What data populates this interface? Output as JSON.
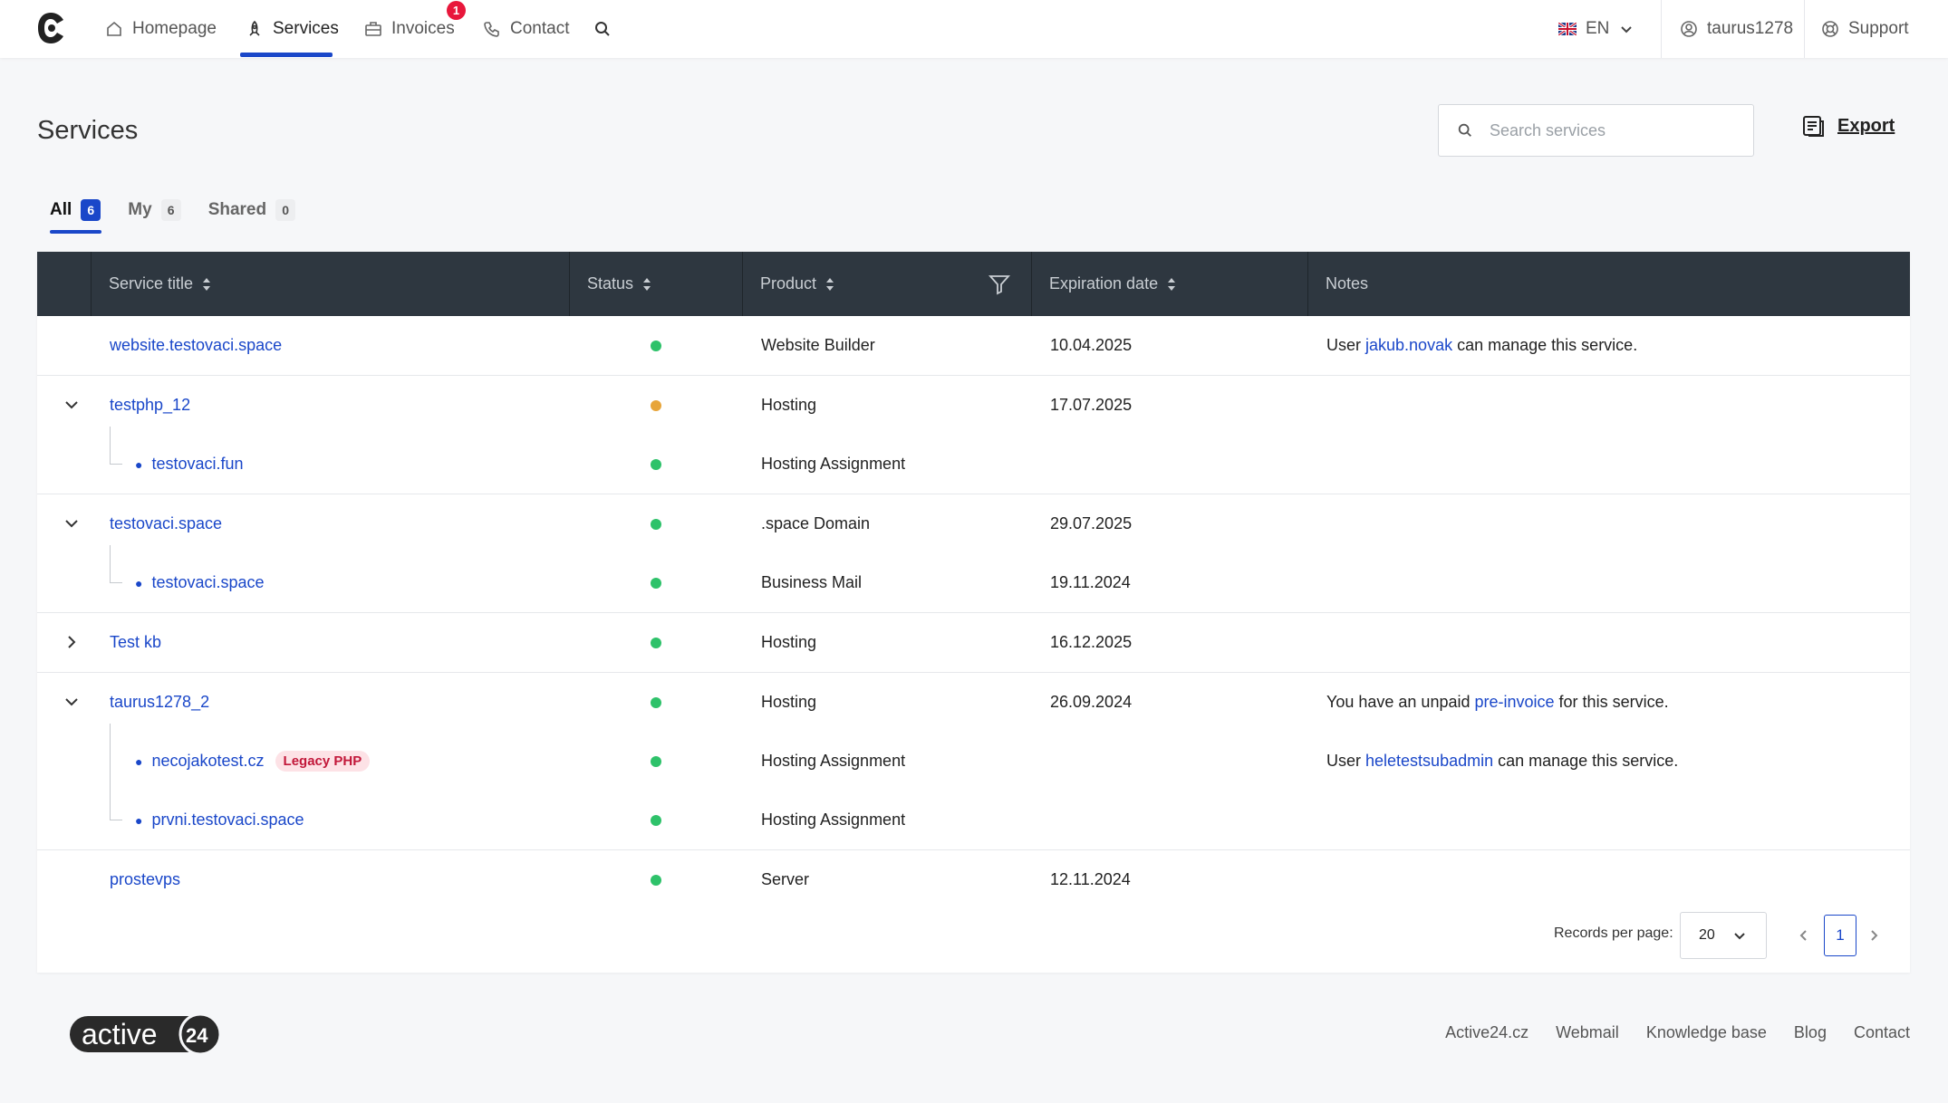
{
  "nav": {
    "items": [
      {
        "label": "Homepage",
        "icon": "home-icon"
      },
      {
        "label": "Services",
        "icon": "rocket-icon"
      },
      {
        "label": "Invoices",
        "icon": "briefcase-icon",
        "badge": "1"
      },
      {
        "label": "Contact",
        "icon": "phone-icon"
      }
    ],
    "language": "EN",
    "username": "taurus1278",
    "support": "Support"
  },
  "page": {
    "title": "Services",
    "search_placeholder": "Search services",
    "export_label": "Export"
  },
  "tabs": [
    {
      "label": "All",
      "count": "6"
    },
    {
      "label": "My",
      "count": "6"
    },
    {
      "label": "Shared",
      "count": "0"
    }
  ],
  "table": {
    "headers": {
      "service_title": "Service title",
      "status": "Status",
      "product": "Product",
      "expiration": "Expiration date",
      "notes": "Notes"
    },
    "rows": {
      "r1": {
        "title": "website.testovaci.space",
        "product": "Website Builder",
        "expiration": "10.04.2025",
        "note_pre": "User ",
        "note_link": "jakub.novak",
        "note_post": " can manage this service."
      },
      "r2": {
        "title": "testphp_12",
        "product": "Hosting",
        "expiration": "17.07.2025"
      },
      "r2a": {
        "title": "testovaci.fun",
        "product": "Hosting Assignment"
      },
      "r3": {
        "title": "testovaci.space",
        "product": ".space Domain",
        "expiration": "29.07.2025"
      },
      "r3a": {
        "title": "testovaci.space",
        "product": "Business Mail",
        "expiration": "19.11.2024"
      },
      "r4": {
        "title": "Test kb",
        "product": "Hosting",
        "expiration": "16.12.2025"
      },
      "r5": {
        "title": "taurus1278_2",
        "product": "Hosting",
        "expiration": "26.09.2024",
        "note_pre": "You have an unpaid ",
        "note_link": "pre-invoice",
        "note_post": " for this service."
      },
      "r5a": {
        "title": "necojakotest.cz",
        "tag": "Legacy PHP",
        "product": "Hosting Assignment",
        "note_pre": "User ",
        "note_link": "heletestsubadmin",
        "note_post": " can manage this service."
      },
      "r5b": {
        "title": "prvni.testovaci.space",
        "product": "Hosting Assignment"
      },
      "r6": {
        "title": "prostevps",
        "product": "Server",
        "expiration": "12.11.2024"
      }
    }
  },
  "pagination": {
    "records_label": "Records per page:",
    "per_page": "20",
    "current_page": "1"
  },
  "footer": {
    "logo_text": "active",
    "logo_num": "24",
    "links": [
      "Active24.cz",
      "Webmail",
      "Knowledge base",
      "Blog",
      "Contact"
    ]
  },
  "colors": {
    "accent": "#1a47c9",
    "status_active": "#2ec26a",
    "status_warning": "#e7a53a",
    "table_header": "#2e3740"
  }
}
